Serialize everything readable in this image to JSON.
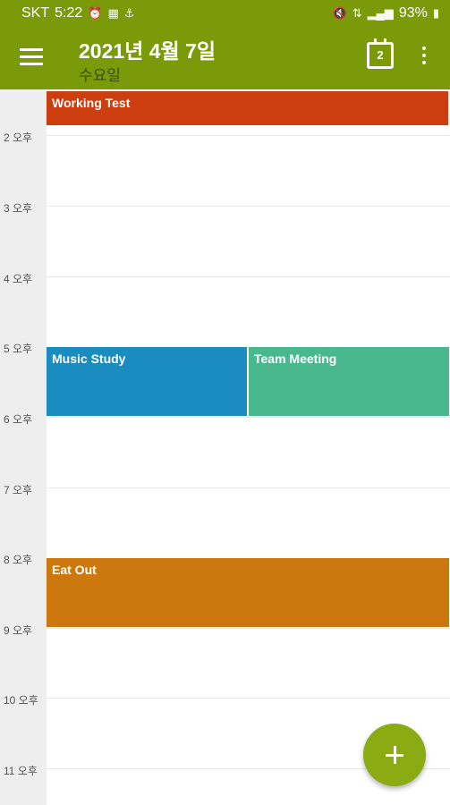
{
  "status_bar": {
    "carrier": "SKT",
    "time": "5:22",
    "icons_left": [
      "alarm-icon",
      "data-saver-icon",
      "usb-icon"
    ],
    "icons_right": [
      "mute-icon",
      "lte-icon",
      "signal-icon",
      "battery-icon"
    ],
    "battery": "93%"
  },
  "app_bar": {
    "title": "2021년 4월 7일",
    "subtitle": "수요일",
    "today_number": "2",
    "color": "#7a9a0a"
  },
  "timeline": {
    "hour_labels": [
      "2 오후",
      "3 오후",
      "4 오후",
      "5 오후",
      "6 오후",
      "7 오후",
      "8 오후",
      "9 오후",
      "10 오후",
      "11 오후"
    ]
  },
  "events": [
    {
      "title": "Working Test",
      "color": "#cc3d10"
    },
    {
      "title": "Music Study",
      "color": "#1a8cbf"
    },
    {
      "title": "Team Meeting",
      "color": "#49b88f"
    },
    {
      "title": "Eat Out",
      "color": "#cc780e"
    }
  ]
}
